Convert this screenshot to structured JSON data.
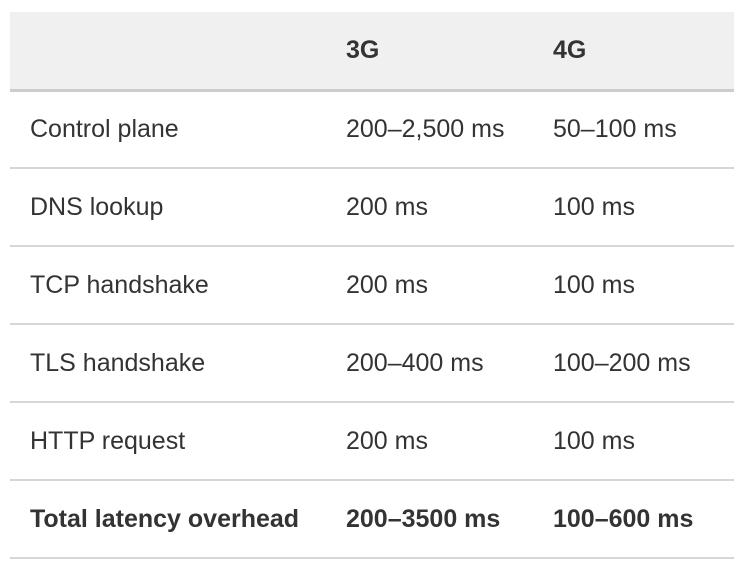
{
  "table": {
    "headers": [
      "",
      "3G",
      "4G"
    ],
    "rows": [
      {
        "label": "Control plane",
        "g3": "200–2,500 ms",
        "g4": "50–100 ms"
      },
      {
        "label": "DNS lookup",
        "g3": "200 ms",
        "g4": "100 ms"
      },
      {
        "label": "TCP handshake",
        "g3": "200 ms",
        "g4": "100 ms"
      },
      {
        "label": "TLS handshake",
        "g3": "200–400 ms",
        "g4": "100–200 ms"
      },
      {
        "label": "HTTP request",
        "g3": "200 ms",
        "g4": "100 ms"
      },
      {
        "label": "Total latency overhead",
        "g3": "200–3500 ms",
        "g4": "100–600 ms"
      }
    ]
  },
  "colors": {
    "header_background": "#f0f0f0",
    "text": "#333333",
    "row_divider": "#d6d6d6"
  }
}
